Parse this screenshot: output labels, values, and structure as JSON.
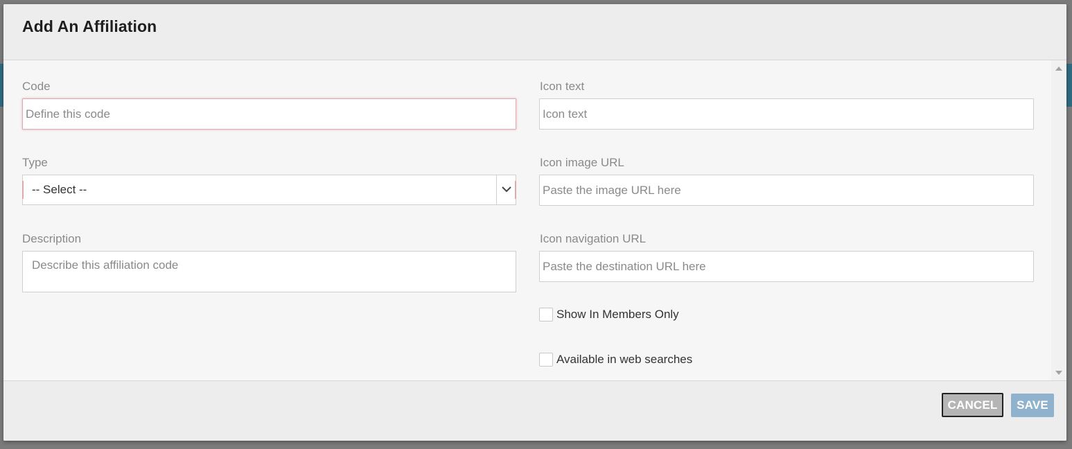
{
  "modal": {
    "title": "Add An Affiliation"
  },
  "form": {
    "code": {
      "label": "Code",
      "placeholder": "Define this code",
      "value": ""
    },
    "type": {
      "label": "Type",
      "selected": "-- Select --"
    },
    "description": {
      "label": "Description",
      "placeholder": "Describe this affiliation code",
      "value": ""
    },
    "icon_text": {
      "label": "Icon text",
      "placeholder": "Icon text",
      "value": ""
    },
    "icon_image_url": {
      "label": "Icon image URL",
      "placeholder": "Paste the image URL here",
      "value": ""
    },
    "icon_navigation_url": {
      "label": "Icon navigation URL",
      "placeholder": "Paste the destination URL here",
      "value": ""
    },
    "show_in_members_only": {
      "label": "Show In Members Only",
      "checked": false
    },
    "available_in_web_searches": {
      "label": "Available in web searches",
      "checked": false
    }
  },
  "footer": {
    "cancel_label": "CANCEL",
    "save_label": "SAVE"
  },
  "colors": {
    "invalid_border": "#e2a8b0",
    "save_button": "#8fb3cc",
    "cancel_button": "#b5b5b5"
  }
}
